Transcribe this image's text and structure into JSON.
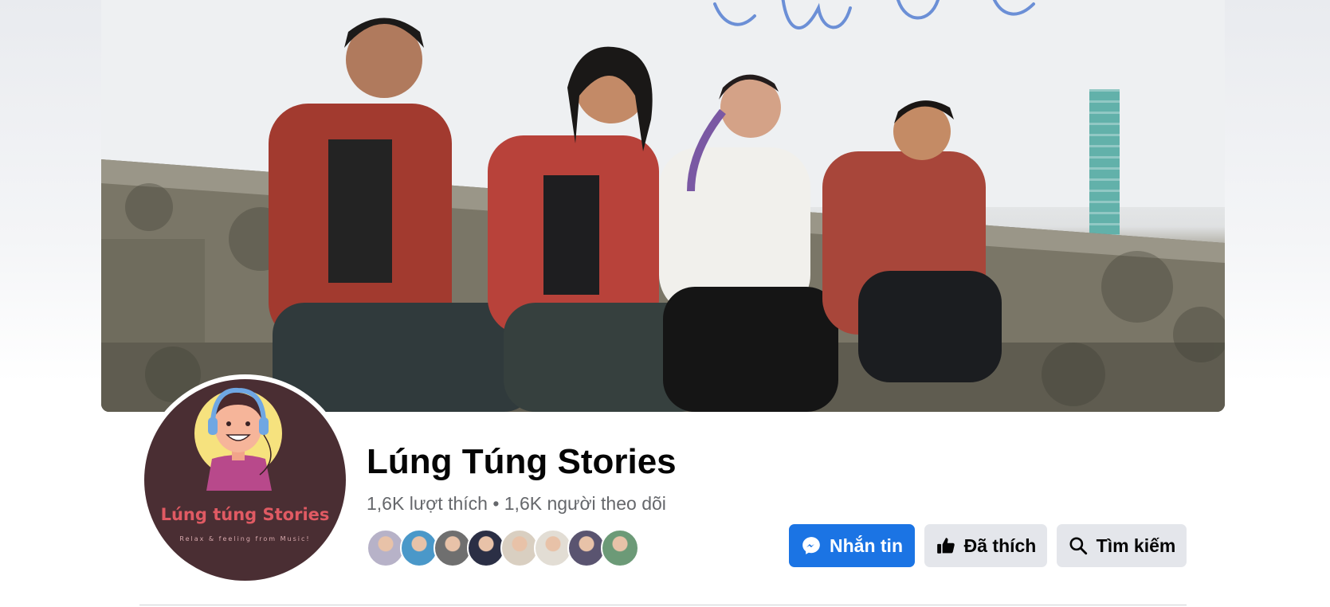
{
  "cover": {
    "script_text": "Lúng túng"
  },
  "avatar": {
    "brand": "Lúng túng Stories",
    "tagline": "Relax & feeling from Music!"
  },
  "page": {
    "title": "Lúng Túng Stories",
    "stats": "1,6K lượt thích • 1,6K người theo dõi"
  },
  "friends": [
    {
      "name": "friend-1",
      "color": "#b7b2c8"
    },
    {
      "name": "friend-2",
      "color": "#4a98c9"
    },
    {
      "name": "friend-3",
      "color": "#6f6f6f"
    },
    {
      "name": "friend-4",
      "color": "#2b2f45"
    },
    {
      "name": "friend-5",
      "color": "#d9cfc1"
    },
    {
      "name": "friend-6",
      "color": "#e2ddd4"
    },
    {
      "name": "friend-7",
      "color": "#5a5470"
    },
    {
      "name": "friend-8",
      "color": "#6c9a77"
    }
  ],
  "actions": {
    "message_label": "Nhắn tin",
    "liked_label": "Đã thích",
    "search_label": "Tìm kiếm"
  },
  "icons": {
    "message": "messenger-icon",
    "liked": "thumbs-up-icon",
    "search": "search-icon"
  },
  "colors": {
    "primary": "#1b74e4",
    "secondary_button": "#e4e6eb",
    "title": "#050505",
    "muted": "#65676b",
    "avatar_bg": "#4a2e33",
    "brand_red": "#e05a63"
  }
}
